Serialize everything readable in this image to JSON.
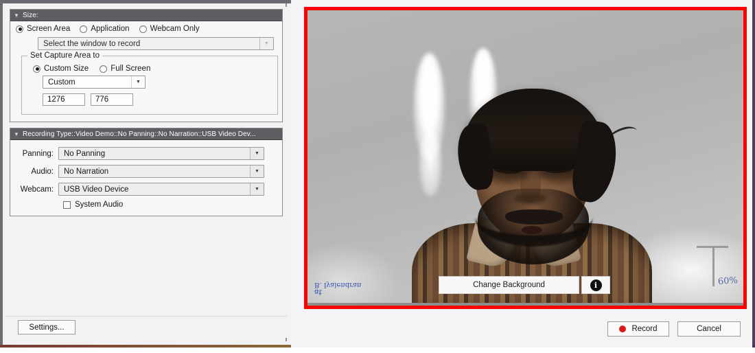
{
  "panels": {
    "size": {
      "header": "Size:",
      "twisty": "▼",
      "modes": [
        {
          "label": "Screen Area",
          "selected": true
        },
        {
          "label": "Application",
          "selected": false
        },
        {
          "label": "Webcam Only",
          "selected": false
        }
      ],
      "window_select": {
        "value": "Select the window to record",
        "disabled": true,
        "arrow": "▼"
      },
      "capture_group": {
        "title": "Set Capture Area to",
        "options": [
          {
            "label": "Custom Size",
            "selected": true
          },
          {
            "label": "Full Screen",
            "selected": false
          }
        ],
        "preset": {
          "value": "Custom",
          "arrow": "▼"
        },
        "width": "1276",
        "height": "776"
      }
    },
    "recording_type": {
      "header": "Recording Type::Video Demo::No Panning::No Narration::USB Video Dev...",
      "twisty": "▼",
      "rows": [
        {
          "label": "Panning:",
          "value": "No Panning",
          "arrow": "▼"
        },
        {
          "label": "Audio:",
          "value": "No Narration",
          "arrow": "▼"
        },
        {
          "label": "Webcam:",
          "value": "USB Video Device",
          "arrow": "▼"
        }
      ],
      "system_audio": {
        "label": "System Audio",
        "checked": false
      }
    }
  },
  "buttons": {
    "settings": "Settings...",
    "record": "Record",
    "cancel": "Cancel"
  },
  "video_overlay": {
    "change_background": "Change Background",
    "info_glyph": "i"
  },
  "whiteboard": {
    "note_line1": "at",
    "note_line2": "B. Iyalendran",
    "blue_scrawl": "60%"
  },
  "colors": {
    "preview_border": "#fe0000",
    "record_dot": "#d61b20",
    "panel_header_bg": "#5e5e62",
    "window_chrome": "#6e6a72"
  }
}
